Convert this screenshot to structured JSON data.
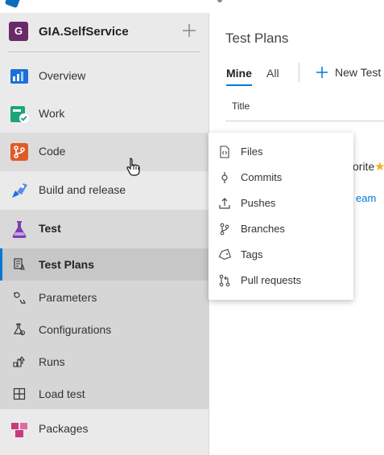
{
  "project": {
    "initial": "G",
    "name": "GIA.SelfService"
  },
  "nav": {
    "overview": "Overview",
    "work": "Work",
    "code": "Code",
    "build": "Build and release",
    "test": "Test",
    "packages": "Packages"
  },
  "test_sub": {
    "plans": "Test Plans",
    "parameters": "Parameters",
    "configurations": "Configurations",
    "runs": "Runs",
    "load": "Load test"
  },
  "main": {
    "title": "Test Plans",
    "tabs": {
      "mine": "Mine",
      "all": "All"
    },
    "new_test": "New Test",
    "column_title": "Title",
    "fragments": {
      "rite": "orite",
      "star": "★",
      "eam": "eam"
    }
  },
  "code_menu": {
    "items": [
      "Files",
      "Commits",
      "Pushes",
      "Branches",
      "Tags",
      "Pull requests"
    ]
  },
  "colors": {
    "accent": "#0078d4",
    "project_badge": "#6a2a6a",
    "favorite_star": "#f2b01e"
  }
}
